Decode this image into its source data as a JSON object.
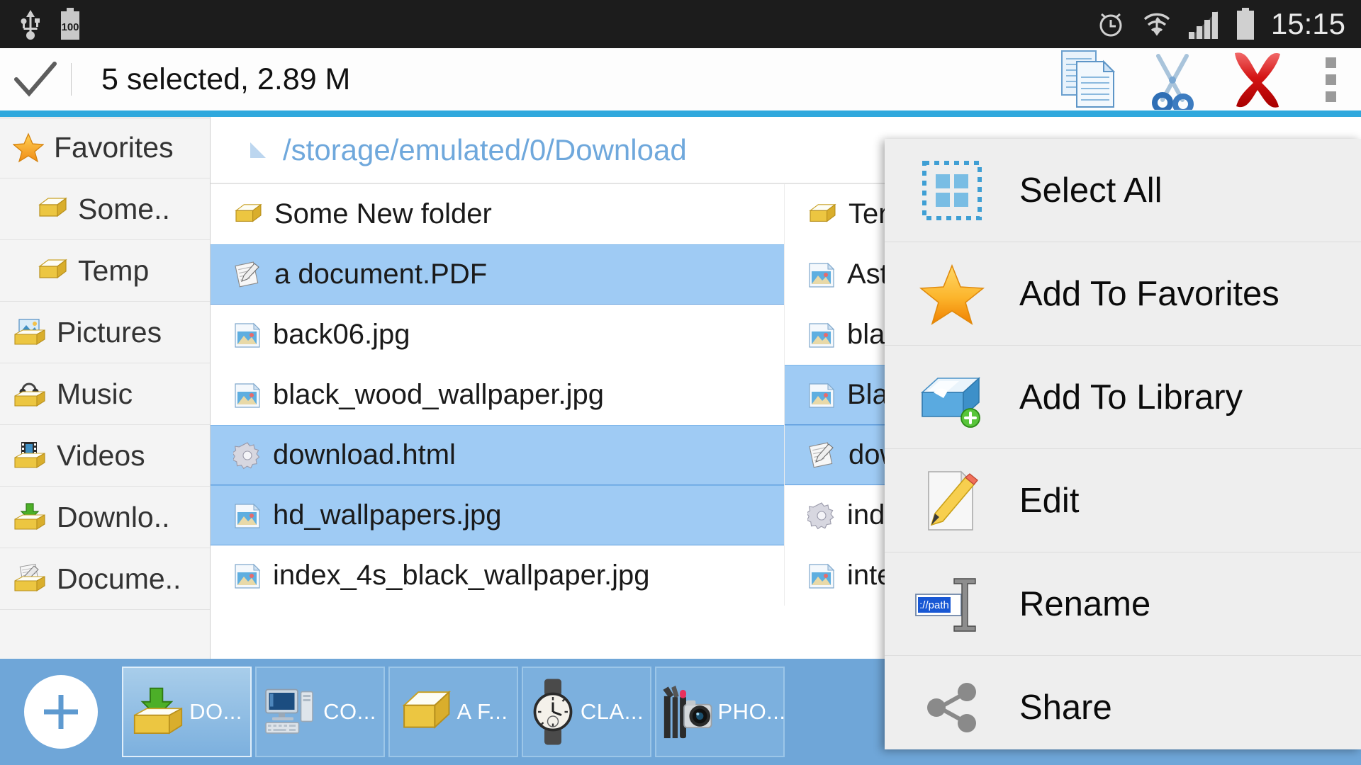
{
  "statusbar": {
    "icons": [
      "usb-icon",
      "battery-icon",
      "alarm-icon",
      "wifi-icon",
      "signal-icon",
      "battery-full-icon"
    ],
    "battery_text": "100",
    "clock": "15:15"
  },
  "actionbar": {
    "check_icon": "checkmark-icon",
    "title": "5 selected, 2.89 M",
    "actions": [
      {
        "name": "copy-button",
        "icon": "copy-documents-icon"
      },
      {
        "name": "cut-button",
        "icon": "scissors-icon"
      },
      {
        "name": "delete-button",
        "icon": "red-x-icon"
      }
    ],
    "overflow_label": "overflow-menu-button"
  },
  "colors": {
    "accent": "#2fa8dd",
    "selection": "#9fcbf4",
    "crumb_text": "#6fa8dc",
    "tabbar": "#6fa6d8",
    "statusbar": "#1c1c1c"
  },
  "sidebar": {
    "items": [
      {
        "label": "Favorites",
        "icon": "star-icon",
        "indent": false
      },
      {
        "label": "Some..",
        "icon": "folder-icon",
        "indent": true
      },
      {
        "label": "Temp",
        "icon": "folder-icon",
        "indent": true
      },
      {
        "label": "Pictures",
        "icon": "pictures-folder-icon",
        "indent": false
      },
      {
        "label": "Music",
        "icon": "music-folder-icon",
        "indent": false
      },
      {
        "label": "Videos",
        "icon": "videos-folder-icon",
        "indent": false
      },
      {
        "label": "Downlo..",
        "icon": "downloads-folder-icon",
        "indent": false
      },
      {
        "label": "Docume..",
        "icon": "documents-folder-icon",
        "indent": false
      }
    ]
  },
  "breadcrumb": {
    "arrow_icon": "up-triangle-icon",
    "path": "/storage/emulated/0/Download"
  },
  "files": {
    "column_left": [
      {
        "name": "Some New folder",
        "icon": "folder-icon",
        "selected": false
      },
      {
        "name": "a document.PDF",
        "icon": "document-icon",
        "selected": true
      },
      {
        "name": "back06.jpg",
        "icon": "image-icon",
        "selected": false
      },
      {
        "name": "black_wood_wallpaper.jpg",
        "icon": "image-icon",
        "selected": false
      },
      {
        "name": "download.html",
        "icon": "gear-icon",
        "selected": true
      },
      {
        "name": "hd_wallpapers.jpg",
        "icon": "image-icon",
        "selected": true
      },
      {
        "name": "index_4s_black_wallpaper.jpg",
        "icon": "image-icon",
        "selected": false
      }
    ],
    "column_right": [
      {
        "name": "Ter",
        "icon": "folder-icon",
        "selected": false
      },
      {
        "name": "Ast",
        "icon": "image-icon",
        "selected": false
      },
      {
        "name": "bla",
        "icon": "image-icon",
        "selected": false
      },
      {
        "name": "Bla",
        "icon": "image-icon",
        "selected": true
      },
      {
        "name": "dow",
        "icon": "document-icon",
        "selected": true
      },
      {
        "name": "ind",
        "icon": "gear-icon",
        "selected": false
      },
      {
        "name": "inte",
        "icon": "image-icon",
        "selected": false
      }
    ]
  },
  "tabbar": {
    "add_label": "plus-icon",
    "tabs": [
      {
        "label": "DO...",
        "icon": "downloads-folder-icon",
        "active": true
      },
      {
        "label": "CO...",
        "icon": "computer-icon",
        "active": false
      },
      {
        "label": "A F...",
        "icon": "folder-icon",
        "active": false
      },
      {
        "label": "CLA...",
        "icon": "watch-icon",
        "active": false
      },
      {
        "label": "PHO...",
        "icon": "camera-makeup-icon",
        "active": false
      }
    ]
  },
  "menu": {
    "items": [
      {
        "label": "Select All",
        "icon": "select-all-icon"
      },
      {
        "label": "Add To Favorites",
        "icon": "star-icon"
      },
      {
        "label": "Add To Library",
        "icon": "add-to-library-icon"
      },
      {
        "label": "Edit",
        "icon": "edit-pencil-icon"
      },
      {
        "label": "Rename",
        "icon": "rename-cursor-icon",
        "icon_text": "://path"
      },
      {
        "label": "Share",
        "icon": "share-icon"
      }
    ]
  }
}
